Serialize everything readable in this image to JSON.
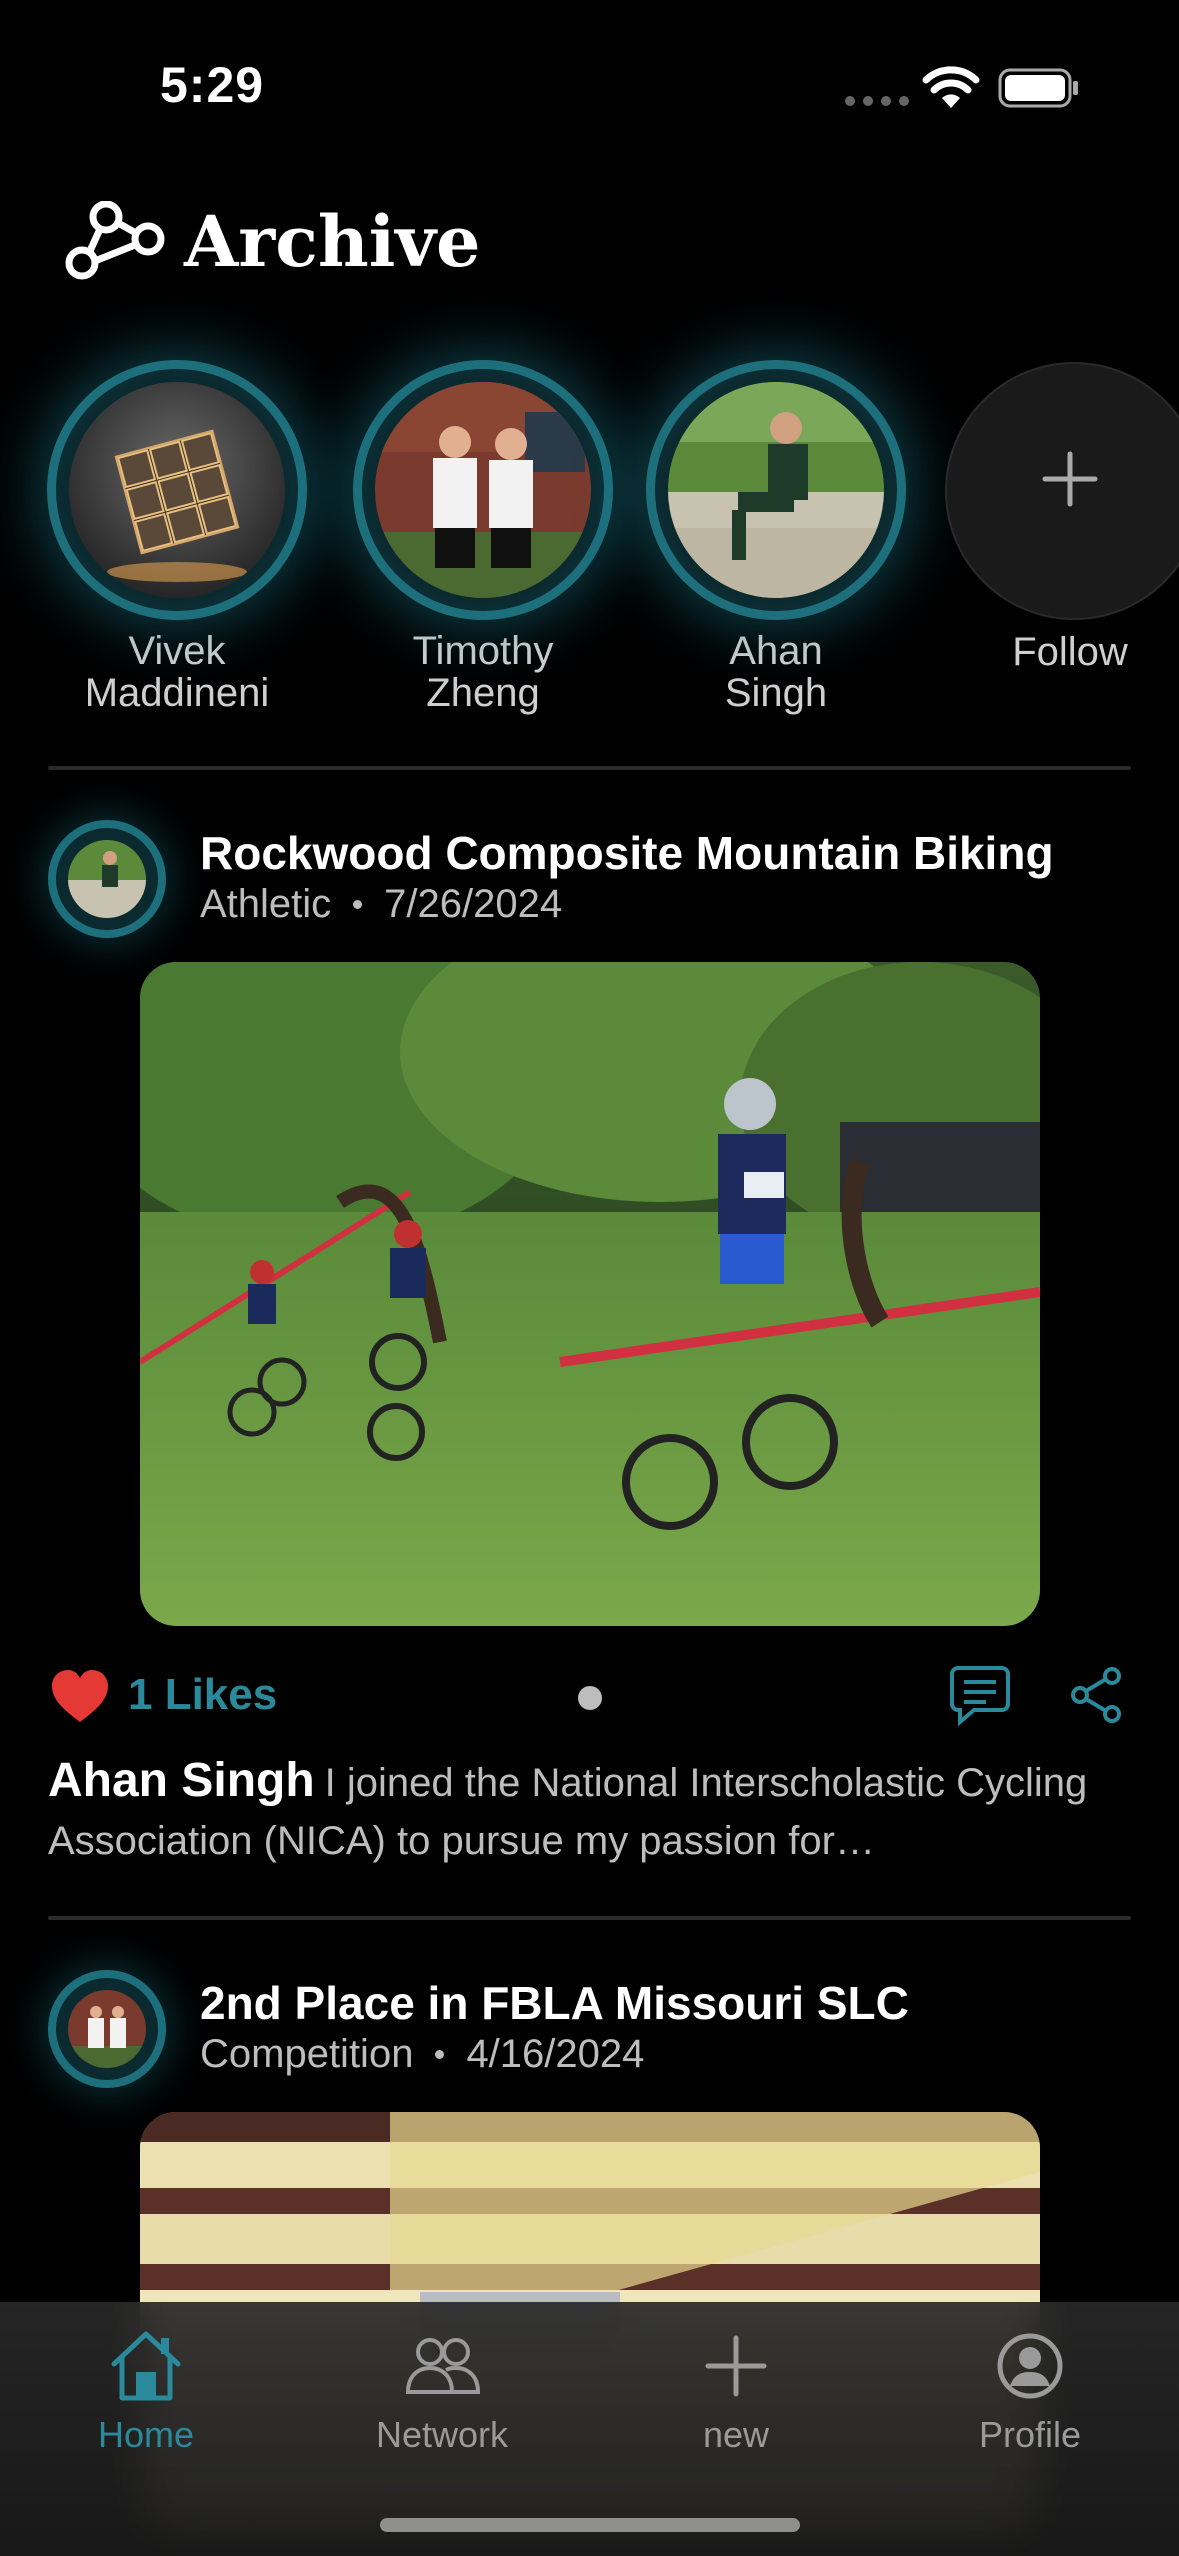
{
  "status": {
    "time": "5:29"
  },
  "header": {
    "title": "Archive"
  },
  "stories": [
    {
      "name_line1": "Vivek",
      "name_line2": "Maddineni"
    },
    {
      "name_line1": "Timothy",
      "name_line2": "Zheng"
    },
    {
      "name_line1": "Ahan",
      "name_line2": "Singh"
    }
  ],
  "follow": {
    "label": "Follow"
  },
  "posts": [
    {
      "title": "Rockwood Composite Mountain Biking",
      "category": "Athletic",
      "date": "7/26/2024",
      "likes_label": "1 Likes",
      "author": "Ahan Singh",
      "caption": "I joined the National Interscholastic Cycling Association (NICA) to pursue my passion for…"
    },
    {
      "title": "2nd Place in FBLA Missouri SLC",
      "category": "Competition",
      "date": "4/16/2024"
    }
  ],
  "tabs": [
    {
      "label": "Home",
      "icon": "home-icon"
    },
    {
      "label": "Network",
      "icon": "people-icon"
    },
    {
      "label": "new",
      "icon": "plus-icon"
    },
    {
      "label": "Profile",
      "icon": "person-circle-icon"
    }
  ],
  "colors": {
    "accent": "#2a8a9b",
    "like": "#e53935",
    "background": "#000000"
  }
}
